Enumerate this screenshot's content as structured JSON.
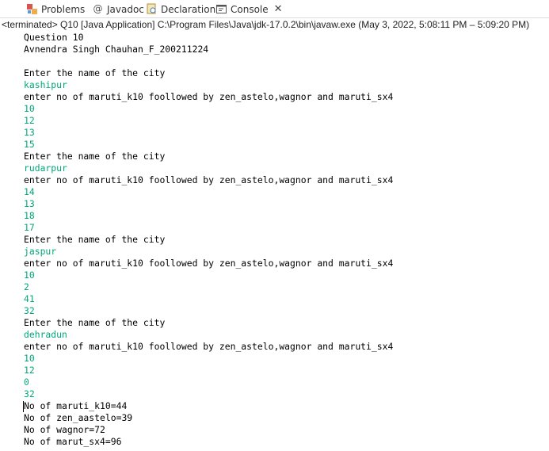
{
  "tabs": [
    {
      "label": "Problems",
      "icon": "problems-icon"
    },
    {
      "label": "Javadoc",
      "icon": "javadoc-icon"
    },
    {
      "label": "Declaration",
      "icon": "declaration-icon"
    },
    {
      "label": "Console",
      "icon": "console-icon",
      "active": true
    }
  ],
  "status": "<terminated> Q10 [Java Application] C:\\Program Files\\Java\\jdk-17.0.2\\bin\\javaw.exe  (May 3, 2022, 5:08:11 PM – 5:09:20 PM)",
  "colors": {
    "output": "#000000",
    "input": "#00a87a"
  },
  "console_lines": [
    {
      "text": "Question 10",
      "type": "out"
    },
    {
      "text": "Avnendra Singh Chauhan_F_200211224",
      "type": "out"
    },
    {
      "text": "",
      "type": "out"
    },
    {
      "text": "Enter the name of the city",
      "type": "out"
    },
    {
      "text": "kashipur",
      "type": "in"
    },
    {
      "text": "enter no of maruti_k10 foollowed by zen_astelo,wagnor and maruti_sx4",
      "type": "out"
    },
    {
      "text": "10",
      "type": "in"
    },
    {
      "text": "12",
      "type": "in"
    },
    {
      "text": "13",
      "type": "in"
    },
    {
      "text": "15",
      "type": "in"
    },
    {
      "text": "Enter the name of the city",
      "type": "out"
    },
    {
      "text": "rudarpur",
      "type": "in"
    },
    {
      "text": "enter no of maruti_k10 foollowed by zen_astelo,wagnor and maruti_sx4",
      "type": "out"
    },
    {
      "text": "14",
      "type": "in"
    },
    {
      "text": "13",
      "type": "in"
    },
    {
      "text": "18",
      "type": "in"
    },
    {
      "text": "17",
      "type": "in"
    },
    {
      "text": "Enter the name of the city",
      "type": "out"
    },
    {
      "text": "jaspur",
      "type": "in"
    },
    {
      "text": "enter no of maruti_k10 foollowed by zen_astelo,wagnor and maruti_sx4",
      "type": "out"
    },
    {
      "text": "10",
      "type": "in"
    },
    {
      "text": "2",
      "type": "in"
    },
    {
      "text": "41",
      "type": "in"
    },
    {
      "text": "32",
      "type": "in"
    },
    {
      "text": "Enter the name of the city",
      "type": "out"
    },
    {
      "text": "dehradun",
      "type": "in"
    },
    {
      "text": "enter no of maruti_k10 foollowed by zen_astelo,wagnor and maruti_sx4",
      "type": "out"
    },
    {
      "text": "10",
      "type": "in"
    },
    {
      "text": "12",
      "type": "in"
    },
    {
      "text": "0",
      "type": "in"
    },
    {
      "text": "32",
      "type": "in"
    },
    {
      "text": "No of maruti_k10=44",
      "type": "out"
    },
    {
      "text": "No of zen_aastelo=39",
      "type": "out"
    },
    {
      "text": "No of wagnor=72",
      "type": "out"
    },
    {
      "text": "No of marut_sx4=96",
      "type": "out"
    }
  ]
}
